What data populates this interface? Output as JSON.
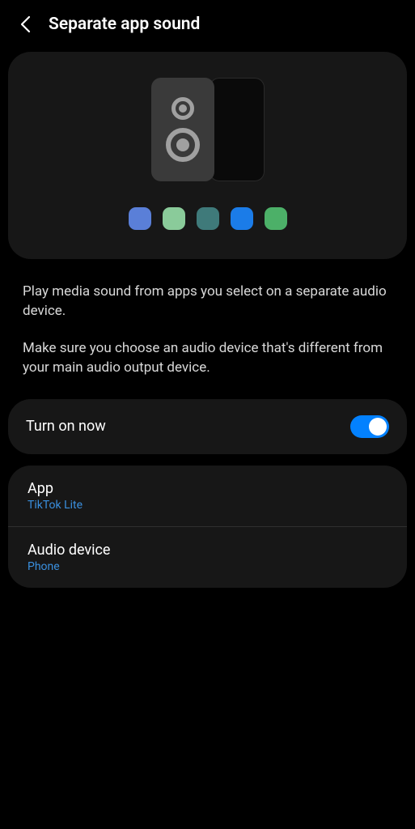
{
  "header": {
    "title": "Separate app sound"
  },
  "description": {
    "para1": "Play media sound from apps you select on a separate audio device.",
    "para2": "Make sure you choose an audio device that's different from your main audio output device."
  },
  "toggle": {
    "label": "Turn on now",
    "enabled": true
  },
  "settings": {
    "app": {
      "title": "App",
      "value": "TikTok Lite"
    },
    "audioDevice": {
      "title": "Audio device",
      "value": "Phone"
    }
  },
  "colors": {
    "accent": "#0381fe",
    "link": "#3a8fde"
  }
}
